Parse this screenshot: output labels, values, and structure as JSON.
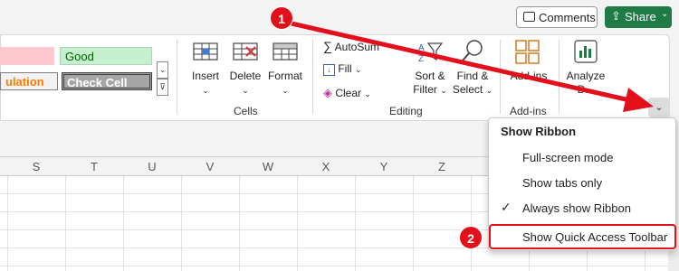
{
  "header": {
    "comments_label": "Comments",
    "share_label": "Share",
    "share_icon": "share-icon"
  },
  "styles": {
    "cells": [
      {
        "label": "",
        "bg": "#ffc7ce",
        "color": "#9c0006"
      },
      {
        "label": "Good",
        "bg": "#c6efce",
        "color": "#006100"
      },
      {
        "label": "ulation",
        "bg": "#f2f2f2",
        "color": "#fa7d00"
      },
      {
        "label": "Check Cell",
        "bg": "#a5a5a5",
        "color": "#ffffff"
      }
    ]
  },
  "cells_group": {
    "name": "Cells",
    "insert": "Insert",
    "delete": "Delete",
    "format": "Format"
  },
  "editing_group": {
    "name": "Editing",
    "autosum": "AutoSum",
    "fill": "Fill",
    "clear": "Clear",
    "sort_filter_1": "Sort &",
    "sort_filter_2": "Filter",
    "find_select_1": "Find &",
    "find_select_2": "Select"
  },
  "addins_group": {
    "name": "Add-ins",
    "addins_label": "Add-ins",
    "analyze_1": "Analyze",
    "analyze_2": "D..."
  },
  "columns": [
    "S",
    "T",
    "U",
    "V",
    "W",
    "X",
    "Y",
    "Z"
  ],
  "menu": {
    "title": "Show Ribbon",
    "items": [
      {
        "label": "Full-screen mode",
        "checked": false
      },
      {
        "label": "Show tabs only",
        "checked": false
      },
      {
        "label": "Always show Ribbon",
        "checked": true
      },
      {
        "label": "Show Quick Access Toolbar",
        "checked": false
      }
    ]
  },
  "annotations": {
    "badge_1": "1",
    "badge_2": "2",
    "accent": "#e3101b"
  }
}
